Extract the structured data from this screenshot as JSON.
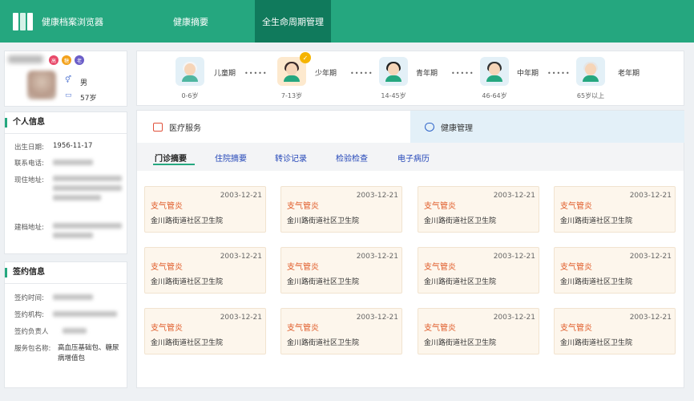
{
  "header": {
    "app_title": "健康档案浏览器",
    "nav": [
      "健康摘要",
      "全生命周期管理"
    ],
    "active_nav": "全生命周期管理"
  },
  "profile": {
    "badges": [
      {
        "label": "高",
        "color": "#e84a6a"
      },
      {
        "label": "糖",
        "color": "#f3a21c"
      },
      {
        "label": "老",
        "color": "#6b5ec8"
      }
    ],
    "gender": "男",
    "age": "57岁"
  },
  "personal": {
    "title": "个人信息",
    "birth_label": "出生日期:",
    "birth_value": "1956-11-17",
    "phone_label": "联系电话:",
    "address_label": "现住地址:",
    "record_address_label": "建档地址:"
  },
  "contract": {
    "title": "签约信息",
    "time_label": "签约时间:",
    "org_label": "签约机构:",
    "person_label": "签约负责人",
    "package_label": "服务包名称:",
    "package_value": "高血压基础包、糖尿病增值包"
  },
  "lifecycle": [
    {
      "name": "儿童期",
      "age": "0-6岁",
      "selected": false,
      "icon": "child-face-icon"
    },
    {
      "name": "少年期",
      "age": "7-13岁",
      "selected": true,
      "icon": "teen-face-icon"
    },
    {
      "name": "青年期",
      "age": "14-45岁",
      "selected": false,
      "icon": "youth-face-icon"
    },
    {
      "name": "中年期",
      "age": "46-64岁",
      "selected": false,
      "icon": "middle-age-face-icon"
    },
    {
      "name": "老年期",
      "age": "65岁以上",
      "selected": false,
      "icon": "elder-face-icon"
    }
  ],
  "lifecycle_dots": "•••••",
  "service_tabs": [
    "医疗服务",
    "健康管理"
  ],
  "sub_tabs": [
    "门诊摘要",
    "住院摘要",
    "转诊记录",
    "检验检查",
    "电子病历"
  ],
  "active_sub_tab": "门诊摘要",
  "visits": [
    {
      "date": "2003-12-21",
      "diagnosis": "支气管炎",
      "hospital": "金川路街道社区卫生院"
    },
    {
      "date": "2003-12-21",
      "diagnosis": "支气管炎",
      "hospital": "金川路街道社区卫生院"
    },
    {
      "date": "2003-12-21",
      "diagnosis": "支气管炎",
      "hospital": "金川路街道社区卫生院"
    },
    {
      "date": "2003-12-21",
      "diagnosis": "支气管炎",
      "hospital": "金川路街道社区卫生院"
    },
    {
      "date": "2003-12-21",
      "diagnosis": "支气管炎",
      "hospital": "金川路街道社区卫生院"
    },
    {
      "date": "2003-12-21",
      "diagnosis": "支气管炎",
      "hospital": "金川路街道社区卫生院"
    },
    {
      "date": "2003-12-21",
      "diagnosis": "支气管炎",
      "hospital": "金川路街道社区卫生院"
    },
    {
      "date": "2003-12-21",
      "diagnosis": "支气管炎",
      "hospital": "金川路街道社区卫生院"
    },
    {
      "date": "2003-12-21",
      "diagnosis": "支气管炎",
      "hospital": "金川路街道社区卫生院"
    },
    {
      "date": "2003-12-21",
      "diagnosis": "支气管炎",
      "hospital": "金川路街道社区卫生院"
    },
    {
      "date": "2003-12-21",
      "diagnosis": "支气管炎",
      "hospital": "金川路街道社区卫生院"
    },
    {
      "date": "2003-12-21",
      "diagnosis": "支气管炎",
      "hospital": "金川路街道社区卫生院"
    }
  ]
}
